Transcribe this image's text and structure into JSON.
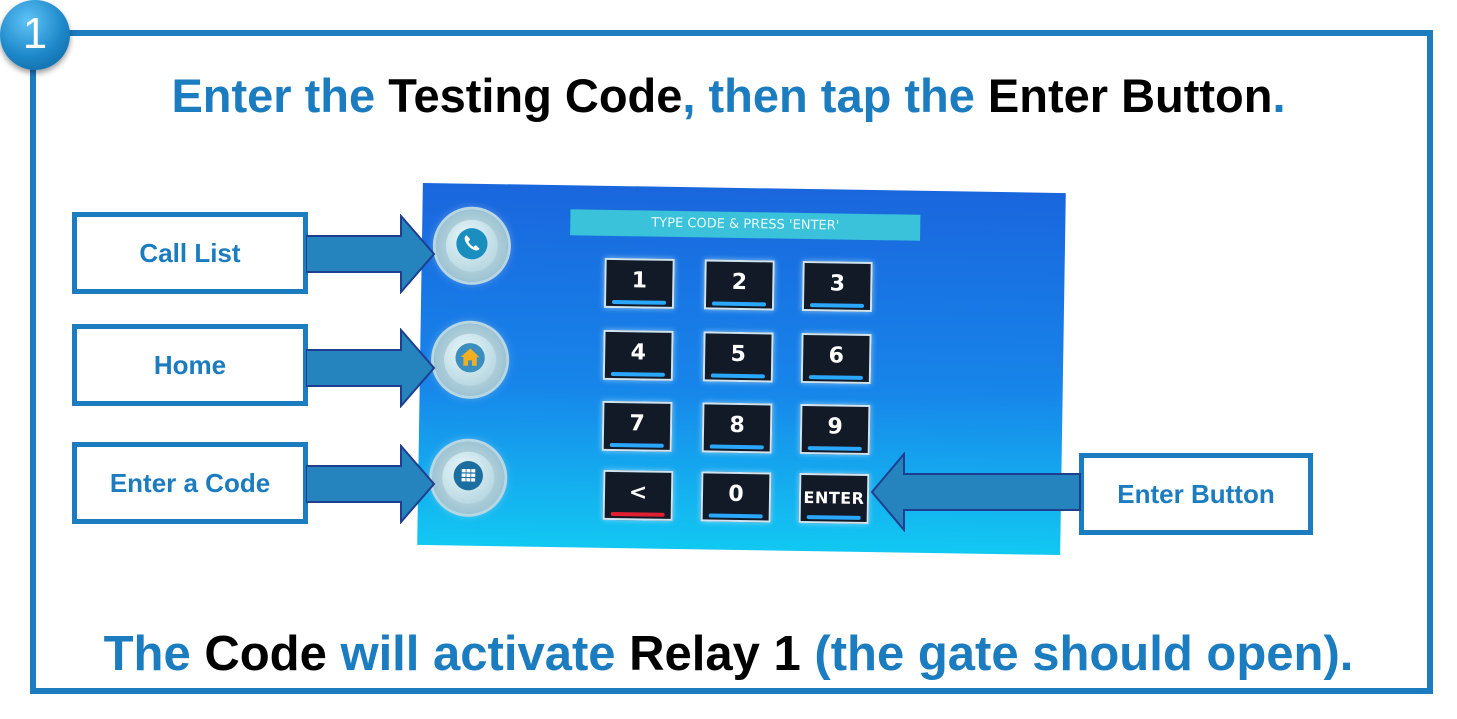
{
  "step_number": "1",
  "heading": {
    "part1": "Enter the ",
    "part2": "Testing Code",
    "part3": ", then tap the ",
    "part4": "Enter Button",
    "part5": "."
  },
  "footer": {
    "part1": "The ",
    "part2": "Code",
    "part3": " will activate ",
    "part4": "Relay 1",
    "part5": " (the gate should open)."
  },
  "screen": {
    "header_text": "TYPE CODE & PRESS 'ENTER'",
    "keys": [
      "1",
      "2",
      "3",
      "4",
      "5",
      "6",
      "7",
      "8",
      "9",
      "<",
      "0",
      "ENTER"
    ]
  },
  "callouts": {
    "call_list": "Call List",
    "home": "Home",
    "enter_code": "Enter a Code",
    "enter_button": "Enter Button"
  },
  "icons": {
    "phone": "phone-icon",
    "home": "home-icon",
    "keypad": "keypad-icon"
  },
  "colors": {
    "accent": "#1b7cc0",
    "screen_top": "#1a66dd",
    "screen_bottom": "#12c8f2"
  }
}
